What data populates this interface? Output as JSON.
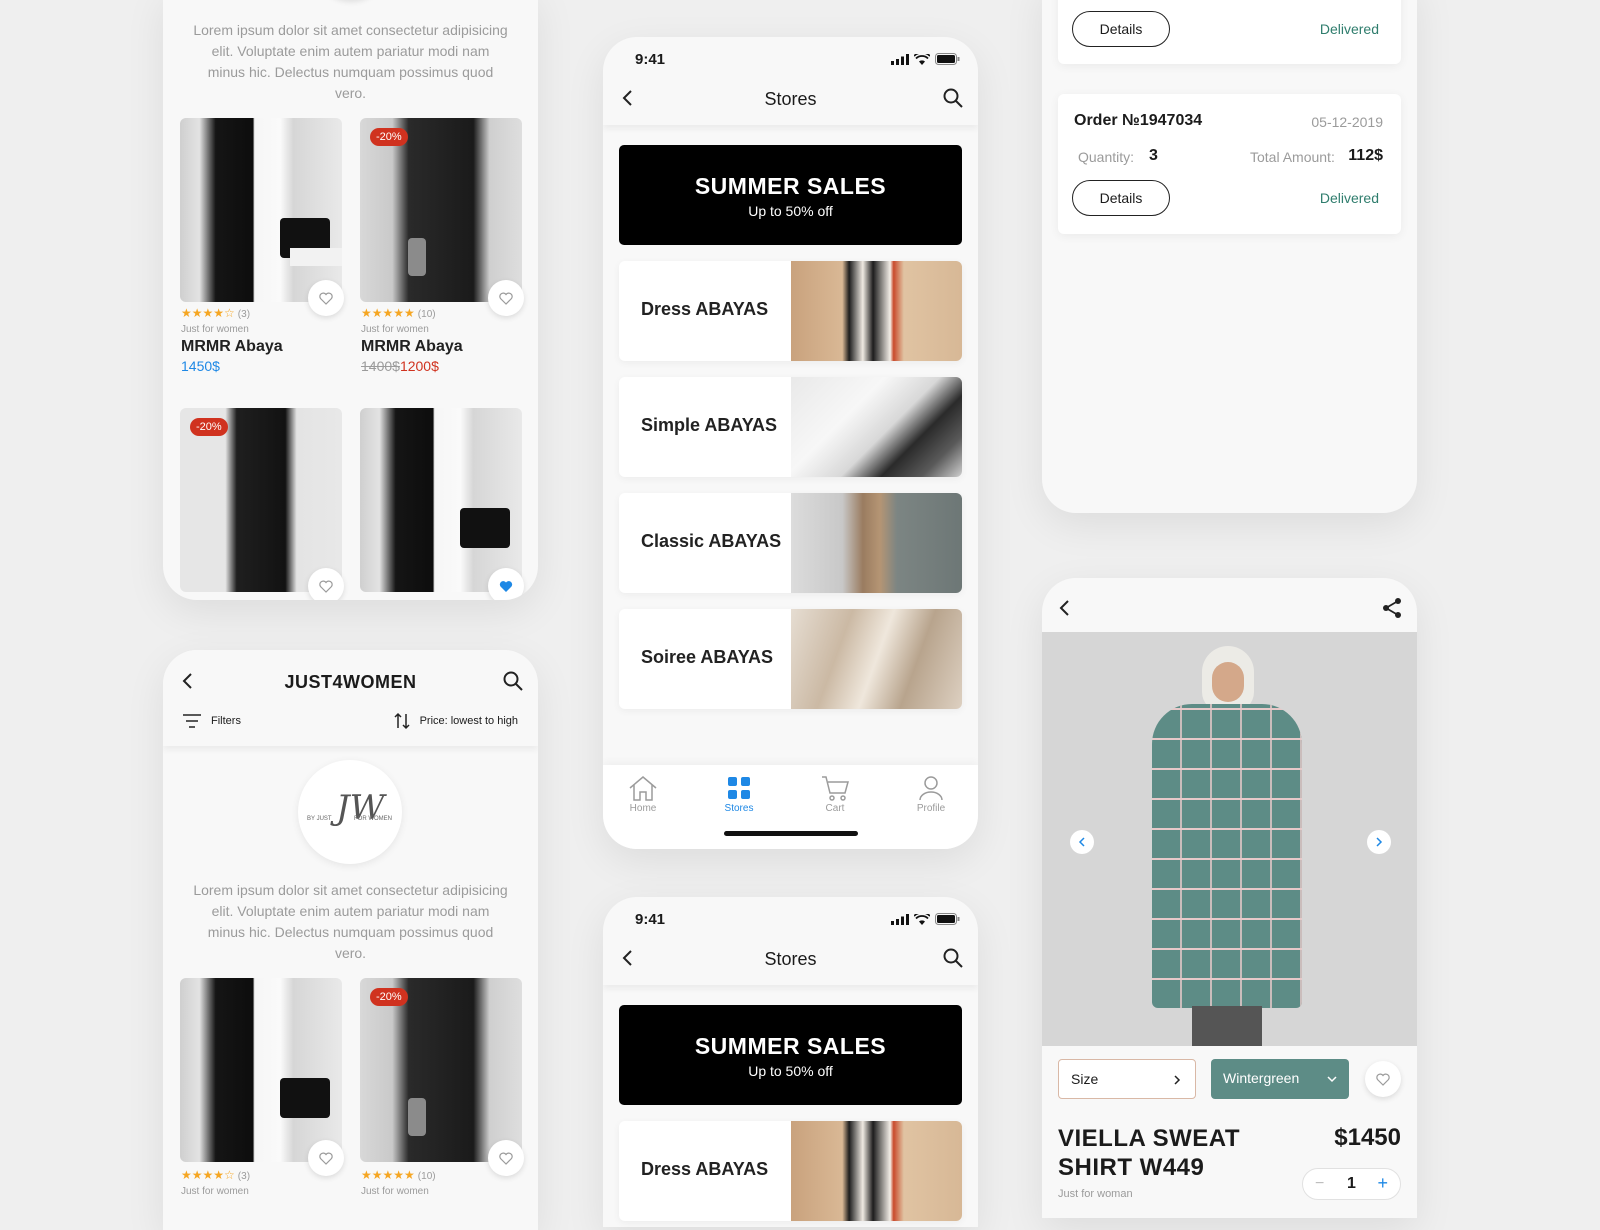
{
  "stores_screen_1": {
    "status_time": "9:41",
    "title": "Stores",
    "banner": {
      "title": "SUMMER SALES",
      "subtitle": "Up to 50% off"
    },
    "categories": [
      "Dress ABAYAS",
      "Simple ABAYAS",
      "Classic ABAYAS",
      "Soiree ABAYAS"
    ],
    "tabs": [
      "Home",
      "Stores",
      "Cart",
      "Profile"
    ],
    "active_tab": "Stores"
  },
  "stores_screen_2": {
    "status_time": "9:41",
    "title": "Stores",
    "banner": {
      "title": "SUMMER SALES",
      "subtitle": "Up to 50% off"
    },
    "categories": [
      "Dress ABAYAS"
    ]
  },
  "brand_screen_top": {
    "description": "Lorem ipsum dolor sit amet consectetur adipisicing elit. Voluptate enim autem pariatur modi nam minus hic. Delectus numquam possimus quod vero.",
    "products": [
      {
        "stars": "★★★★☆",
        "count": "(3)",
        "brand": "Just for women",
        "name": "MRMR Abaya",
        "price": "1450$"
      },
      {
        "badge": "-20%",
        "stars": "★★★★★",
        "count": "(10)",
        "brand": "Just for women",
        "name": "MRMR Abaya",
        "old_price": "1400$",
        "price": "1200$"
      },
      {
        "badge": "-20%"
      },
      {}
    ]
  },
  "brand_screen": {
    "title": "JUST4WOMEN",
    "filters_label": "Filters",
    "sort_label": "Price: lowest to high",
    "logo_text": {
      "left": "BY JUST",
      "mark": "JW",
      "right": "FOR WOMEN"
    },
    "description": "Lorem ipsum dolor sit amet consectetur adipisicing elit. Voluptate enim autem pariatur modi nam minus hic. Delectus numquam possimus quod vero.",
    "products": [
      {
        "stars": "★★★★☆",
        "count": "(3)",
        "brand": "Just for women"
      },
      {
        "badge": "-20%",
        "stars": "★★★★★",
        "count": "(10)",
        "brand": "Just for women"
      }
    ]
  },
  "orders_screen": {
    "order_top": {
      "details": "Details",
      "status": "Delivered"
    },
    "order": {
      "number": "Order №1947034",
      "date": "05-12-2019",
      "quantity_label": "Quantity:",
      "quantity": "3",
      "total_label": "Total Amount:",
      "total": "112$",
      "details": "Details",
      "status": "Delivered"
    }
  },
  "product_screen": {
    "size_label": "Size",
    "color_label": "Wintergreen",
    "name_line1": "VIELLA SWEAT",
    "name_line2": "SHIRT W449",
    "price": "$1450",
    "brand": "Just for woman",
    "quantity": "1",
    "colors": {
      "wintergreen": "#5d8c86",
      "accent_blue": "#1e88e5",
      "sale_red": "#d0321f"
    }
  }
}
